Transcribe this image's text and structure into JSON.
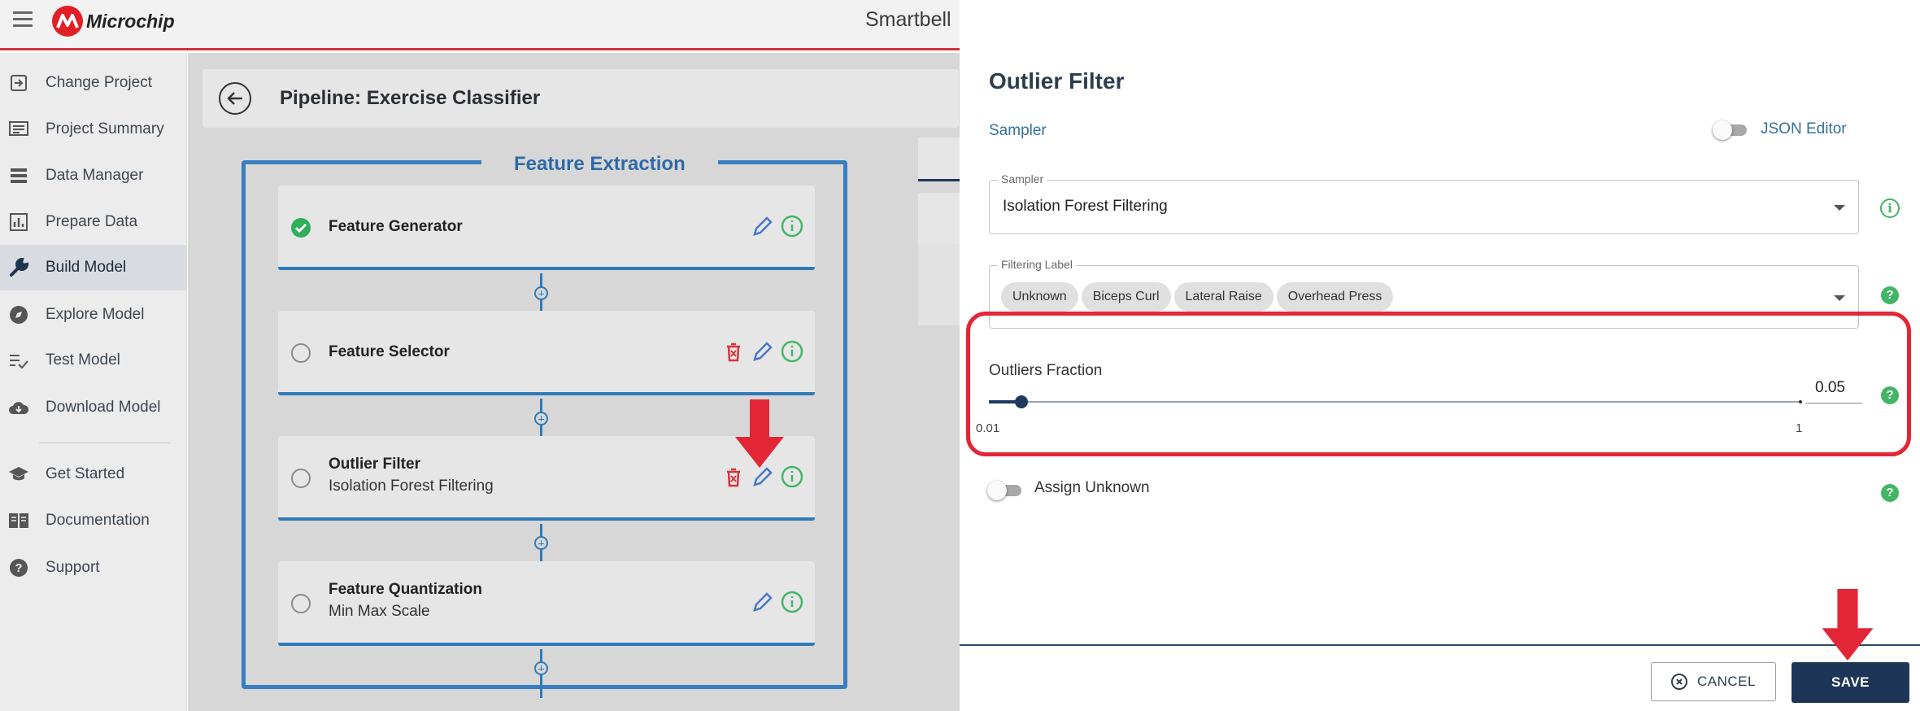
{
  "app": {
    "brand": "Microchip",
    "title": "Smartbell"
  },
  "nav": {
    "items": [
      {
        "label": "Change Project",
        "icon": "change-project-icon"
      },
      {
        "label": "Project Summary",
        "icon": "summary-icon"
      },
      {
        "label": "Data Manager",
        "icon": "data-manager-icon"
      },
      {
        "label": "Prepare Data",
        "icon": "prepare-data-icon"
      },
      {
        "label": "Build Model",
        "icon": "wrench-icon"
      },
      {
        "label": "Explore Model",
        "icon": "compass-icon"
      },
      {
        "label": "Test Model",
        "icon": "checklist-icon"
      },
      {
        "label": "Download Model",
        "icon": "cloud-download-icon"
      },
      {
        "label": "Get Started",
        "icon": "graduation-cap-icon"
      },
      {
        "label": "Documentation",
        "icon": "book-icon"
      },
      {
        "label": "Support",
        "icon": "help-icon"
      }
    ],
    "active": "Build Model"
  },
  "pipeline": {
    "title": "Pipeline: Exercise Classifier",
    "section_title": "Feature Extraction",
    "steps": [
      {
        "title": "Feature Generator",
        "subtitle": "",
        "status": "done"
      },
      {
        "title": "Feature Selector",
        "subtitle": "",
        "status": "pending"
      },
      {
        "title": "Outlier Filter",
        "subtitle": "Isolation Forest Filtering",
        "status": "pending"
      },
      {
        "title": "Feature Quantization",
        "subtitle": "Min Max Scale",
        "status": "pending"
      }
    ]
  },
  "drawer": {
    "title": "Outlier Filter",
    "subtitle": "Sampler",
    "json_editor_label": "JSON Editor",
    "json_editor_on": false,
    "sampler": {
      "label": "Sampler",
      "value": "Isolation Forest Filtering"
    },
    "filtering_label": {
      "label": "Filtering Label",
      "chips": [
        "Unknown",
        "Biceps Curl",
        "Lateral Raise",
        "Overhead Press"
      ]
    },
    "outliers_fraction": {
      "label": "Outliers Fraction",
      "value": "0.05",
      "min": "0.01",
      "max": "1",
      "fraction_of_range": 0.04
    },
    "assign_unknown": {
      "label": "Assign Unknown",
      "on": false
    },
    "cancel_label": "CANCEL",
    "save_label": "SAVE"
  },
  "colors": {
    "accent_red": "#e32636",
    "brand_blue": "#2f7ab8",
    "navy": "#1d3557",
    "success_green": "#43b566"
  }
}
